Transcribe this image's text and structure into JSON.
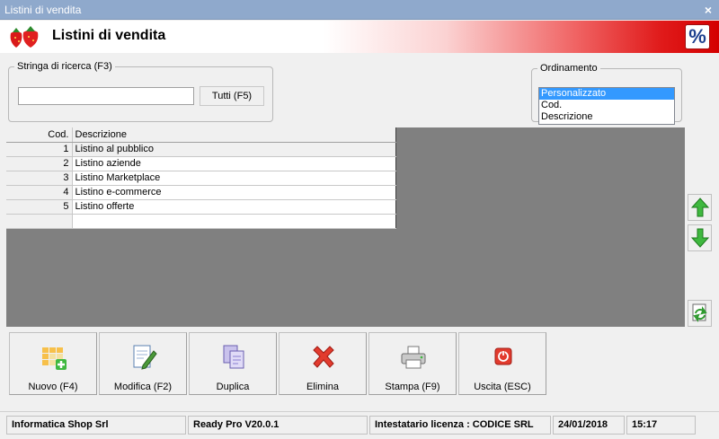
{
  "window": {
    "title": "Listini di vendita",
    "close_glyph": "×"
  },
  "header": {
    "title": "Listini di vendita",
    "logo_icon": "strawberries-icon",
    "percent_badge": "%"
  },
  "search": {
    "legend": "Stringa di ricerca (F3)",
    "value": "",
    "placeholder": "",
    "all_button": "Tutti (F5)"
  },
  "ordering": {
    "legend": "Ordinamento",
    "options": [
      "Personalizzato",
      "Cod.",
      "Descrizione"
    ],
    "selected": "Personalizzato"
  },
  "grid": {
    "columns": [
      "Cod.",
      "Descrizione"
    ],
    "rows": [
      {
        "cod": "1",
        "descrizione": "Listino al pubblico"
      },
      {
        "cod": "2",
        "descrizione": "Listino aziende"
      },
      {
        "cod": "3",
        "descrizione": "Listino Marketplace"
      },
      {
        "cod": "4",
        "descrizione": "Listino e-commerce"
      },
      {
        "cod": "5",
        "descrizione": "Listino offerte"
      },
      {
        "cod": "",
        "descrizione": ""
      }
    ]
  },
  "side_buttons": {
    "up_icon": "arrow-up-icon",
    "down_icon": "arrow-down-icon",
    "refresh_icon": "refresh-page-icon"
  },
  "toolbar": [
    {
      "label": "Nuovo (F4)",
      "icon": "new-grid-icon"
    },
    {
      "label": "Modifica (F2)",
      "icon": "edit-document-icon"
    },
    {
      "label": "Duplica",
      "icon": "duplicate-icon"
    },
    {
      "label": "Elimina",
      "icon": "delete-x-icon"
    },
    {
      "label": "Stampa (F9)",
      "icon": "printer-icon"
    },
    {
      "label": "Uscita (ESC)",
      "icon": "power-exit-icon"
    }
  ],
  "status": {
    "company": "Informatica Shop Srl",
    "version": "Ready Pro V20.0.1",
    "license": "Intestatario licenza : CODICE SRL",
    "date": "24/01/2018",
    "time": "15:17"
  },
  "colors": {
    "accent_red": "#d40000",
    "selection_blue": "#3399ff",
    "title_bar": "#8fa9cc",
    "grid_background": "#808080"
  }
}
